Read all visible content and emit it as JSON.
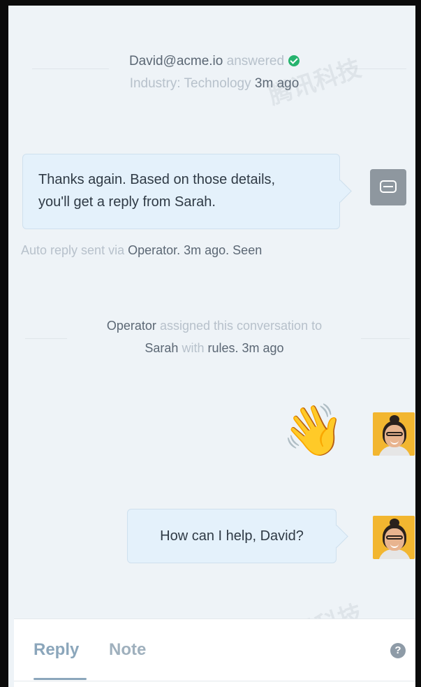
{
  "events": {
    "answered": {
      "user": "David@acme.io",
      "verb": "answered",
      "field": "Industry: Technology",
      "time": "3m ago"
    },
    "assigned": {
      "actor": "Operator",
      "text1": "assigned this conversation to",
      "assignee": "Sarah",
      "with": "with",
      "rules": "rules.",
      "time": "3m ago"
    }
  },
  "bot_message": {
    "line1": "Thanks again. Based on those details,",
    "line2": "you'll get a reply from Sarah.",
    "meta_prefix": "Auto reply sent via",
    "meta_rest": "Operator. 3m ago. Seen"
  },
  "agent_messages": {
    "wave": "👋",
    "question": "How can I help, David?"
  },
  "composer": {
    "tab_reply": "Reply",
    "tab_note": "Note",
    "help": "?"
  },
  "watermark": "腾讯科技",
  "colors": {
    "accent": "#8ba6bb",
    "success": "#26b36e",
    "bubble": "#e4f1fb",
    "panel_bg": "#eef3f7",
    "avatar_bg": "#f2b630"
  }
}
